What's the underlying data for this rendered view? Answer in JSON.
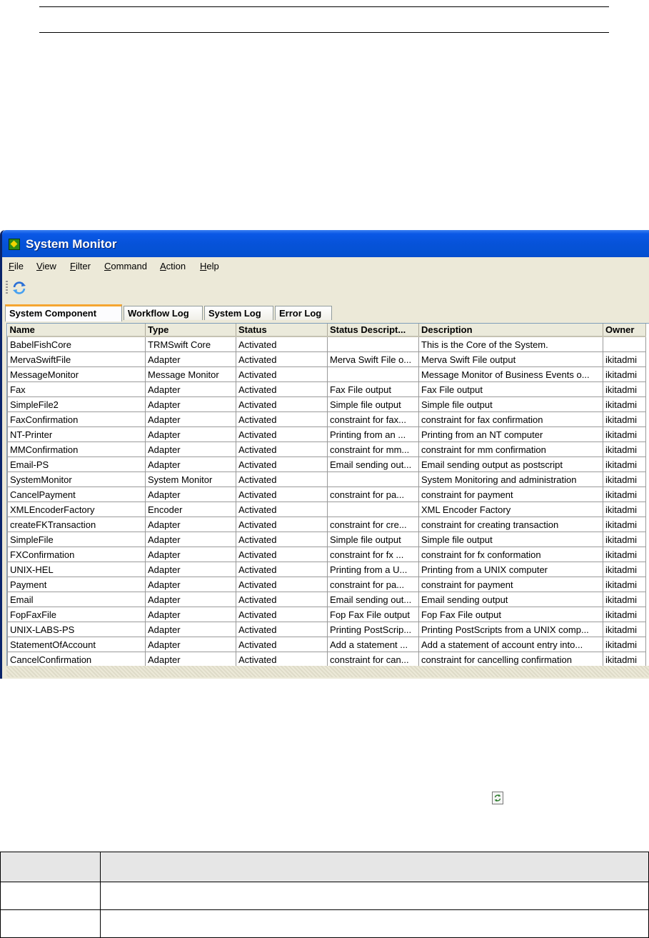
{
  "window": {
    "title": "System Monitor",
    "menu": [
      "File",
      "View",
      "Filter",
      "Command",
      "Action",
      "Help"
    ],
    "tabs": [
      "System Component",
      "Workflow Log",
      "System Log",
      "Error Log"
    ],
    "active_tab": "System Component"
  },
  "table": {
    "columns": [
      "Name",
      "Type",
      "Status",
      "Status Descript...",
      "Description",
      "Owner"
    ],
    "rows": [
      [
        "BabelFishCore",
        "TRMSwift Core",
        "Activated",
        "",
        "This is the Core of the System.",
        ""
      ],
      [
        "MervaSwiftFile",
        "Adapter",
        "Activated",
        "Merva Swift File o...",
        "Merva Swift File output",
        "ikitadmi"
      ],
      [
        "MessageMonitor",
        "Message Monitor",
        "Activated",
        "",
        "Message Monitor of Business Events o...",
        "ikitadmi"
      ],
      [
        "Fax",
        "Adapter",
        "Activated",
        "Fax File output",
        "Fax File output",
        "ikitadmi"
      ],
      [
        "SimpleFile2",
        "Adapter",
        "Activated",
        "Simple file output",
        "Simple file output",
        "ikitadmi"
      ],
      [
        "FaxConfirmation",
        "Adapter",
        "Activated",
        "constraint for fax...",
        "constraint for fax confirmation",
        "ikitadmi"
      ],
      [
        "NT-Printer",
        "Adapter",
        "Activated",
        "Printing from an ...",
        "Printing from an NT computer",
        "ikitadmi"
      ],
      [
        "MMConfirmation",
        "Adapter",
        "Activated",
        "constraint for mm...",
        "constraint for mm confirmation",
        "ikitadmi"
      ],
      [
        "Email-PS",
        "Adapter",
        "Activated",
        "Email sending out...",
        "Email sending output as postscript",
        "ikitadmi"
      ],
      [
        "SystemMonitor",
        "System Monitor",
        "Activated",
        "",
        "System Monitoring and administration",
        "ikitadmi"
      ],
      [
        "CancelPayment",
        "Adapter",
        "Activated",
        "constraint for pa...",
        "constraint for payment",
        "ikitadmi"
      ],
      [
        "XMLEncoderFactory",
        "Encoder",
        "Activated",
        "",
        "XML Encoder Factory",
        "ikitadmi"
      ],
      [
        "createFKTransaction",
        "Adapter",
        "Activated",
        "constraint for cre...",
        "constraint for creating transaction",
        "ikitadmi"
      ],
      [
        "SimpleFile",
        "Adapter",
        "Activated",
        "Simple file output",
        "Simple file output",
        "ikitadmi"
      ],
      [
        "FXConfirmation",
        "Adapter",
        "Activated",
        "constraint for fx ...",
        "constraint for fx conformation",
        "ikitadmi"
      ],
      [
        "UNIX-HEL",
        "Adapter",
        "Activated",
        "Printing from a U...",
        "Printing from a UNIX computer",
        "ikitadmi"
      ],
      [
        "Payment",
        "Adapter",
        "Activated",
        "constraint for pa...",
        "constraint for payment",
        "ikitadmi"
      ],
      [
        "Email",
        "Adapter",
        "Activated",
        "Email sending out...",
        "Email sending output",
        "ikitadmi"
      ],
      [
        "FopFaxFile",
        "Adapter",
        "Activated",
        "Fop Fax File output",
        "Fop Fax File output",
        "ikitadmi"
      ],
      [
        "UNIX-LABS-PS",
        "Adapter",
        "Activated",
        "Printing PostScrip...",
        "Printing PostScripts from a UNIX comp...",
        "ikitadmi"
      ],
      [
        "StatementOfAccount",
        "Adapter",
        "Activated",
        "Add a statement ...",
        "Add a statement of account entry into...",
        "ikitadmi"
      ],
      [
        "CancelConfirmation",
        "Adapter",
        "Activated",
        "constraint for can...",
        "constraint for cancelling confirmation",
        "ikitadmi"
      ]
    ]
  },
  "icons": {
    "app": "system-monitor-icon",
    "toolbar_refresh": "refresh-icon",
    "inline_refresh": "refresh-icon"
  },
  "colors": {
    "titlebar": "#0553d7",
    "active_tab_accent": "#f5a530",
    "window_bg": "#ece9d8"
  }
}
